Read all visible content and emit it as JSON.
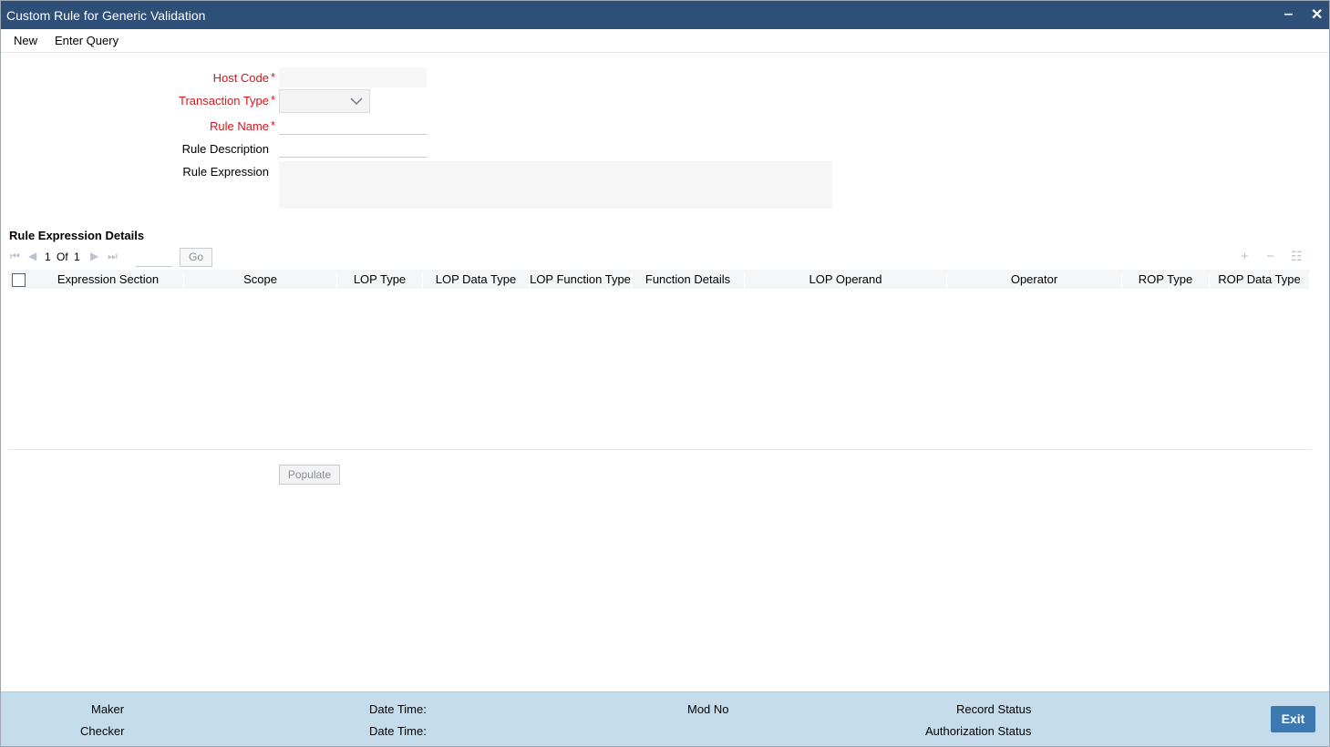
{
  "window": {
    "title": "Custom Rule for Generic Validation",
    "minimize_icon": "minimize-icon",
    "close_icon": "close-icon"
  },
  "menu": {
    "new": "New",
    "enter_query": "Enter Query"
  },
  "form": {
    "host_code": {
      "label": "Host Code",
      "value": ""
    },
    "transaction_type": {
      "label": "Transaction Type",
      "value": ""
    },
    "rule_name": {
      "label": "Rule Name",
      "value": ""
    },
    "rule_description": {
      "label": "Rule Description",
      "value": ""
    },
    "rule_expression": {
      "label": "Rule Expression",
      "value": ""
    },
    "required_mark": "*"
  },
  "details": {
    "title": "Rule Expression Details",
    "pager": {
      "current": "1",
      "of": "Of",
      "total": "1",
      "go": "Go"
    },
    "columns": [
      "Expression Section",
      "Scope",
      "LOP Type",
      "LOP Data Type",
      "LOP Function Type",
      "Function Details",
      "LOP Operand",
      "Operator",
      "ROP Type",
      "ROP Data Type"
    ],
    "rows": []
  },
  "populate_label": "Populate",
  "footer": {
    "maker": "Maker",
    "checker": "Checker",
    "date_time_1": "Date Time:",
    "date_time_2": "Date Time:",
    "mod_no": "Mod No",
    "record_status": "Record Status",
    "authorization_status": "Authorization Status",
    "exit": "Exit"
  },
  "colors": {
    "titlebar": "#2d4f78",
    "required": "#d4161c",
    "footer": "#c5dced",
    "exit_button": "#3c79b0"
  }
}
